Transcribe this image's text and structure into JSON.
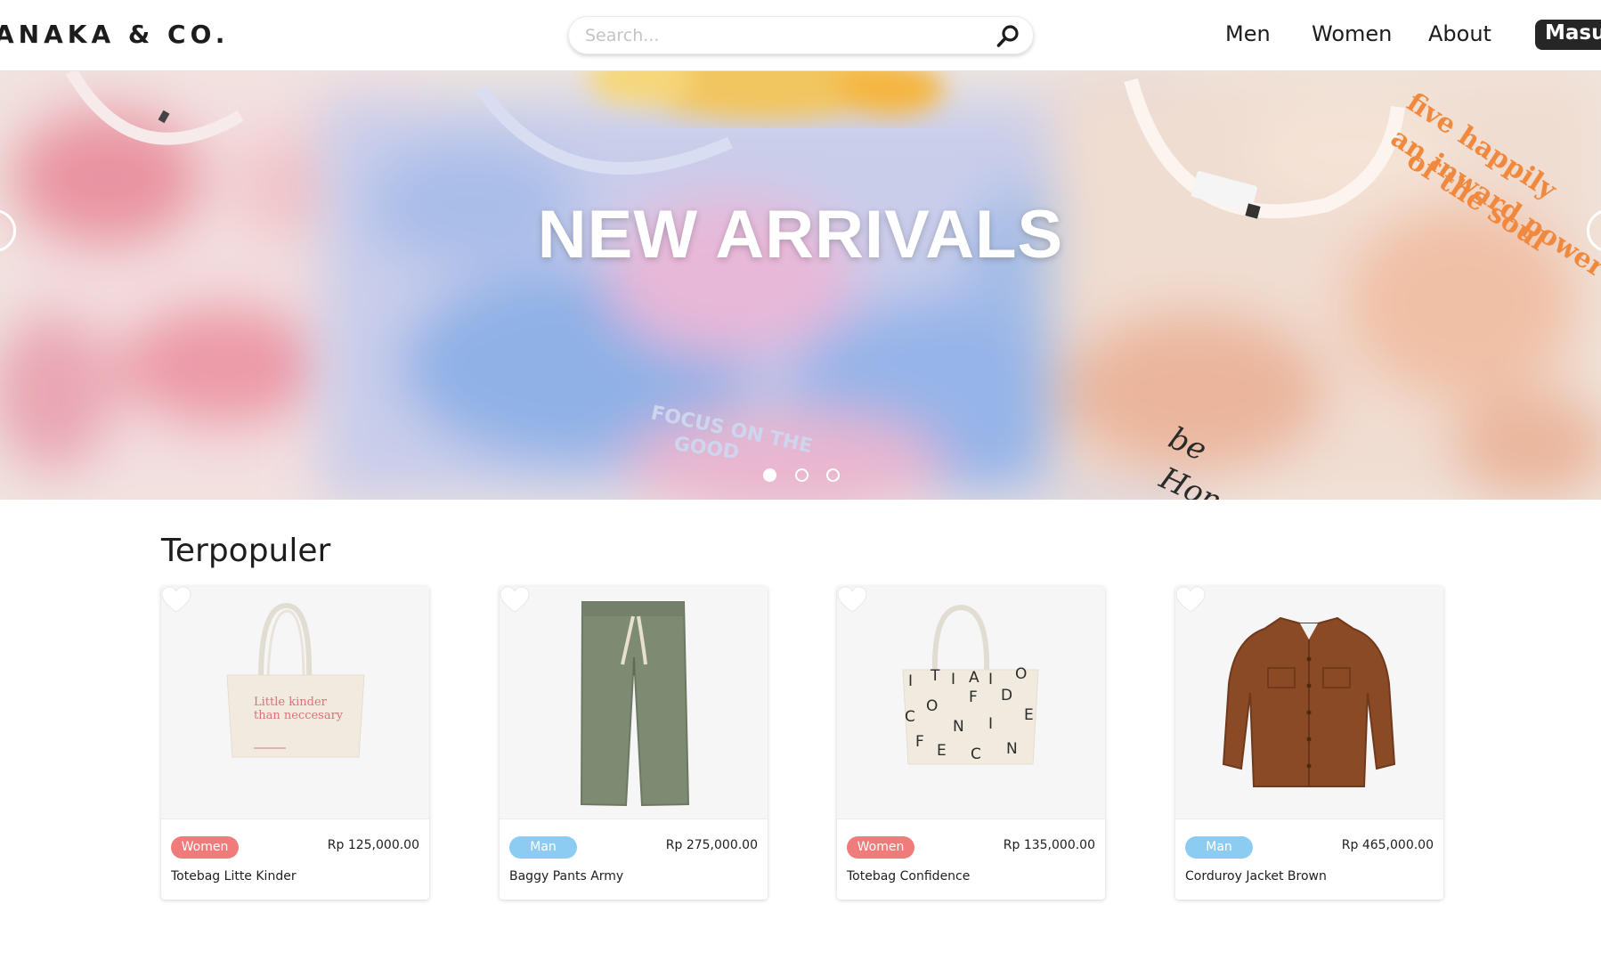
{
  "header": {
    "logo": "ANAKA & CO.",
    "search_placeholder": "Search...",
    "nav": [
      "Men",
      "Women",
      "About"
    ],
    "login_label": "Masuk"
  },
  "hero": {
    "title": "NEW ARRIVALS",
    "slide_count": 3,
    "active_slide": 1
  },
  "section": {
    "title": "Terpopuler"
  },
  "products": [
    {
      "category": "Women",
      "price": "Rp 125,000.00",
      "name": "Totebag Litte Kinder",
      "image": "totebag-icon"
    },
    {
      "category": "Man",
      "price": "Rp 275,000.00",
      "name": "Baggy Pants Army",
      "image": "pants-icon"
    },
    {
      "category": "Women",
      "price": "Rp 135,000.00",
      "name": "Totebag Confidence",
      "image": "totebag-icon"
    },
    {
      "category": "Man",
      "price": "Rp 465,000.00",
      "name": "Corduroy Jacket Brown",
      "image": "jacket-icon"
    }
  ],
  "colors": {
    "women_badge": "#f07b7b",
    "man_badge": "#8ccbf2",
    "button_dark": "#262626"
  }
}
